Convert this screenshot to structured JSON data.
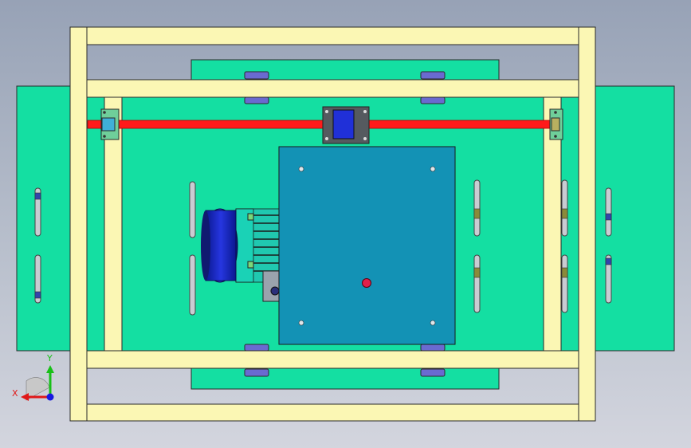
{
  "viewport": {
    "background_top": "#97a2b6",
    "background_bottom": "#d3d5de"
  },
  "colors": {
    "frame_yellow": "#fbf7b4",
    "plate_green": "#14dfa2",
    "motor_plate": "#1392b5",
    "motor_body_blue": "#1723b8",
    "shaft_red": "#ff1a1a",
    "bearing_cyan": "#3fb0d8",
    "slot_gray": "#c9ccd2",
    "clamp_purple": "#6a6ad0",
    "outline": "#2a2a2a"
  },
  "triad": {
    "x_label": "X",
    "y_label": "Y",
    "x_color": "#e01818",
    "y_color": "#18c018",
    "z_color": "#1818e0"
  }
}
